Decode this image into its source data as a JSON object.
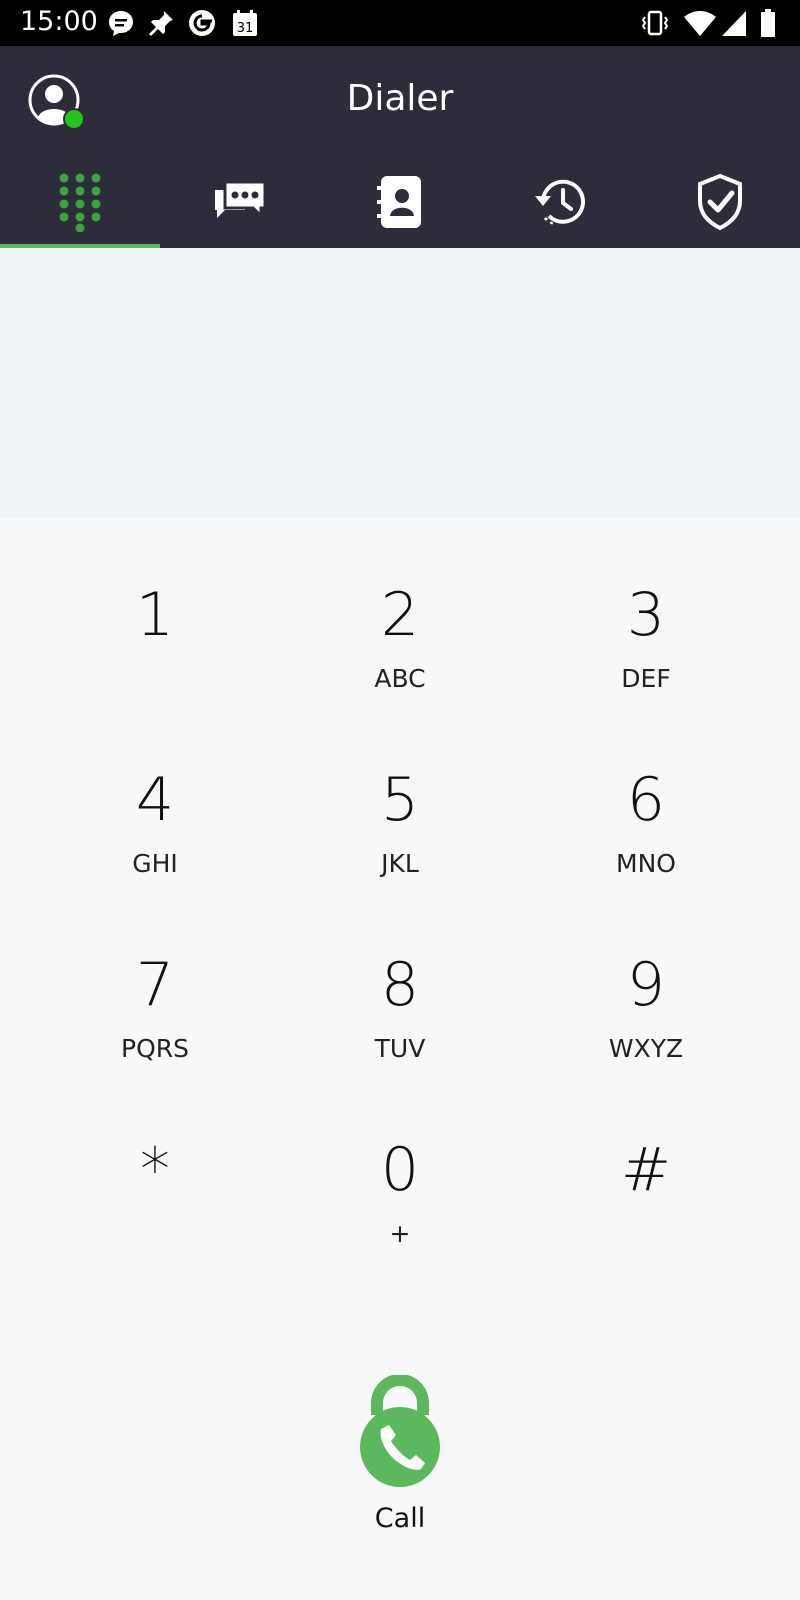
{
  "status_bar": {
    "time": "15:00",
    "left_icons": [
      "message-bubble-icon",
      "pin-icon",
      "google-icon",
      "calendar-icon"
    ],
    "calendar_day": "31",
    "right_icons": [
      "vibrate-icon",
      "wifi-icon",
      "cell-signal-icon",
      "battery-icon"
    ]
  },
  "app_bar": {
    "title": "Dialer",
    "avatar_status_color": "#22c51e"
  },
  "tabs": [
    {
      "icon": "dialpad-icon",
      "active": true
    },
    {
      "icon": "messages-icon",
      "active": false
    },
    {
      "icon": "contacts-icon",
      "active": false
    },
    {
      "icon": "history-icon",
      "active": false
    },
    {
      "icon": "shield-check-icon",
      "active": false
    }
  ],
  "dial_input": {
    "value": ""
  },
  "keypad": [
    {
      "digit": "1",
      "letters": ""
    },
    {
      "digit": "2",
      "letters": "ABC"
    },
    {
      "digit": "3",
      "letters": "DEF"
    },
    {
      "digit": "4",
      "letters": "GHI"
    },
    {
      "digit": "5",
      "letters": "JKL"
    },
    {
      "digit": "6",
      "letters": "MNO"
    },
    {
      "digit": "7",
      "letters": "PQRS"
    },
    {
      "digit": "8",
      "letters": "TUV"
    },
    {
      "digit": "9",
      "letters": "WXYZ"
    },
    {
      "digit": "*",
      "letters": ""
    },
    {
      "digit": "0",
      "letters": "+"
    },
    {
      "digit": "#",
      "letters": ""
    }
  ],
  "call": {
    "label": "Call",
    "color": "#5cb85c"
  },
  "colors": {
    "header": "#2d2c3a",
    "accent": "#5cb85c",
    "display_bg": "#f1f4f7",
    "page_bg": "#f7f8f9"
  }
}
